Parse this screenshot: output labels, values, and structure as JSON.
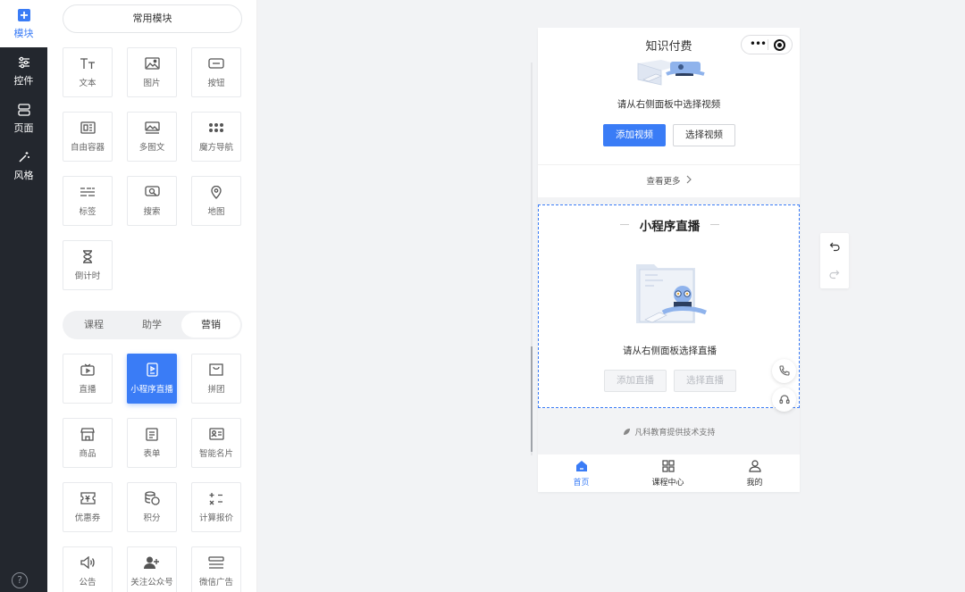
{
  "rail": {
    "items": [
      {
        "label": "模块",
        "icon": "plus-square-icon"
      },
      {
        "label": "控件",
        "icon": "sliders-icon"
      },
      {
        "label": "页面",
        "icon": "pages-icon"
      },
      {
        "label": "风格",
        "icon": "magic-wand-icon"
      }
    ],
    "help": "?"
  },
  "panel": {
    "common_title": "常用模块",
    "common_modules": [
      {
        "label": "文本",
        "icon": "text-icon"
      },
      {
        "label": "图片",
        "icon": "image-icon"
      },
      {
        "label": "按钮",
        "icon": "button-icon"
      },
      {
        "label": "自由容器",
        "icon": "container-icon"
      },
      {
        "label": "多图文",
        "icon": "multi-image-icon"
      },
      {
        "label": "魔方导航",
        "icon": "grid-dots-icon"
      },
      {
        "label": "标签",
        "icon": "tag-icon"
      },
      {
        "label": "搜索",
        "icon": "search-icon"
      },
      {
        "label": "地图",
        "icon": "map-pin-icon"
      },
      {
        "label": "倒计时",
        "icon": "hourglass-icon"
      }
    ],
    "tabs": [
      "课程",
      "助学",
      "营销"
    ],
    "active_tab": "营销",
    "marketing_modules": [
      {
        "label": "直播",
        "icon": "tv-icon"
      },
      {
        "label": "小程序直播",
        "icon": "mini-live-icon"
      },
      {
        "label": "拼团",
        "icon": "bag-icon"
      },
      {
        "label": "商品",
        "icon": "shop-icon"
      },
      {
        "label": "表单",
        "icon": "form-icon"
      },
      {
        "label": "智能名片",
        "icon": "card-icon"
      },
      {
        "label": "优惠券",
        "icon": "coupon-icon"
      },
      {
        "label": "积分",
        "icon": "coins-icon"
      },
      {
        "label": "计算报价",
        "icon": "calculator-icon"
      },
      {
        "label": "公告",
        "icon": "speaker-icon"
      },
      {
        "label": "关注公众号",
        "icon": "add-user-icon"
      },
      {
        "label": "微信广告",
        "icon": "ad-icon"
      }
    ],
    "selected_module": "小程序直播"
  },
  "phone": {
    "title": "知识付费",
    "capsule_dots": "•••",
    "video": {
      "hint": "请从右侧面板中选择视频",
      "add_label": "添加视频",
      "choose_label": "选择视频"
    },
    "more": "查看更多",
    "live": {
      "title": "小程序直播",
      "hint": "请从右侧面板选择直播",
      "add_label": "添加直播",
      "choose_label": "选择直播"
    },
    "powered_by": "凡科教育提供技术支持",
    "tabbar": [
      {
        "label": "首页",
        "icon": "home-icon"
      },
      {
        "label": "课程中心",
        "icon": "apps-icon"
      },
      {
        "label": "我的",
        "icon": "user-icon"
      }
    ]
  },
  "colors": {
    "accent": "#3a7cf6",
    "rail_bg": "#23272e",
    "canvas_bg": "#f2f3f5"
  }
}
